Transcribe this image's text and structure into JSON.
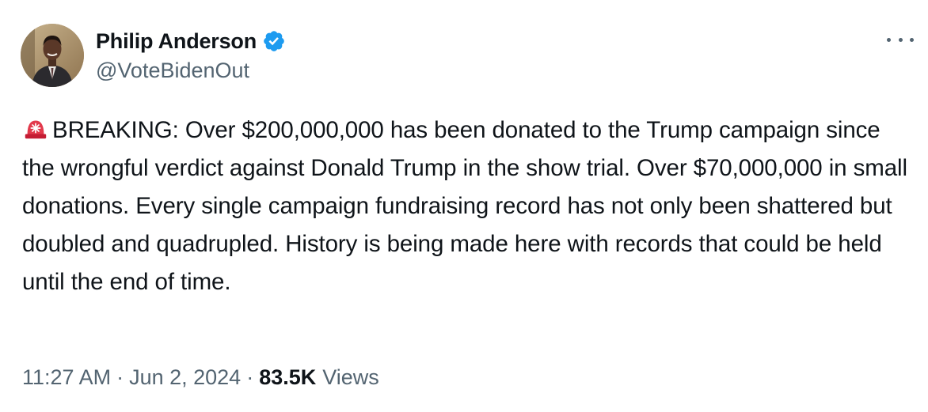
{
  "author": {
    "display_name": "Philip Anderson",
    "handle": "@VoteBidenOut",
    "verified": true,
    "verified_color": "#1d9bf0",
    "avatar": "profile-photo"
  },
  "tweet": {
    "emoji": "siren-emoji",
    "text": "BREAKING: Over $200,000,000 has been donated to the Trump campaign since the wrongful verdict against Donald Trump in the show trial. Over $70,000,000 in small donations. Every single campaign fundraising record has not only been shattered but doubled and quadrupled. History is being made here with records that could be held until the end of time."
  },
  "meta": {
    "time": "11:27 AM",
    "separator": "·",
    "date": "Jun 2, 2024",
    "views_count": "83.5K",
    "views_label": "Views"
  },
  "colors": {
    "text_primary": "#0f1419",
    "text_secondary": "#536471",
    "accent": "#1d9bf0"
  }
}
